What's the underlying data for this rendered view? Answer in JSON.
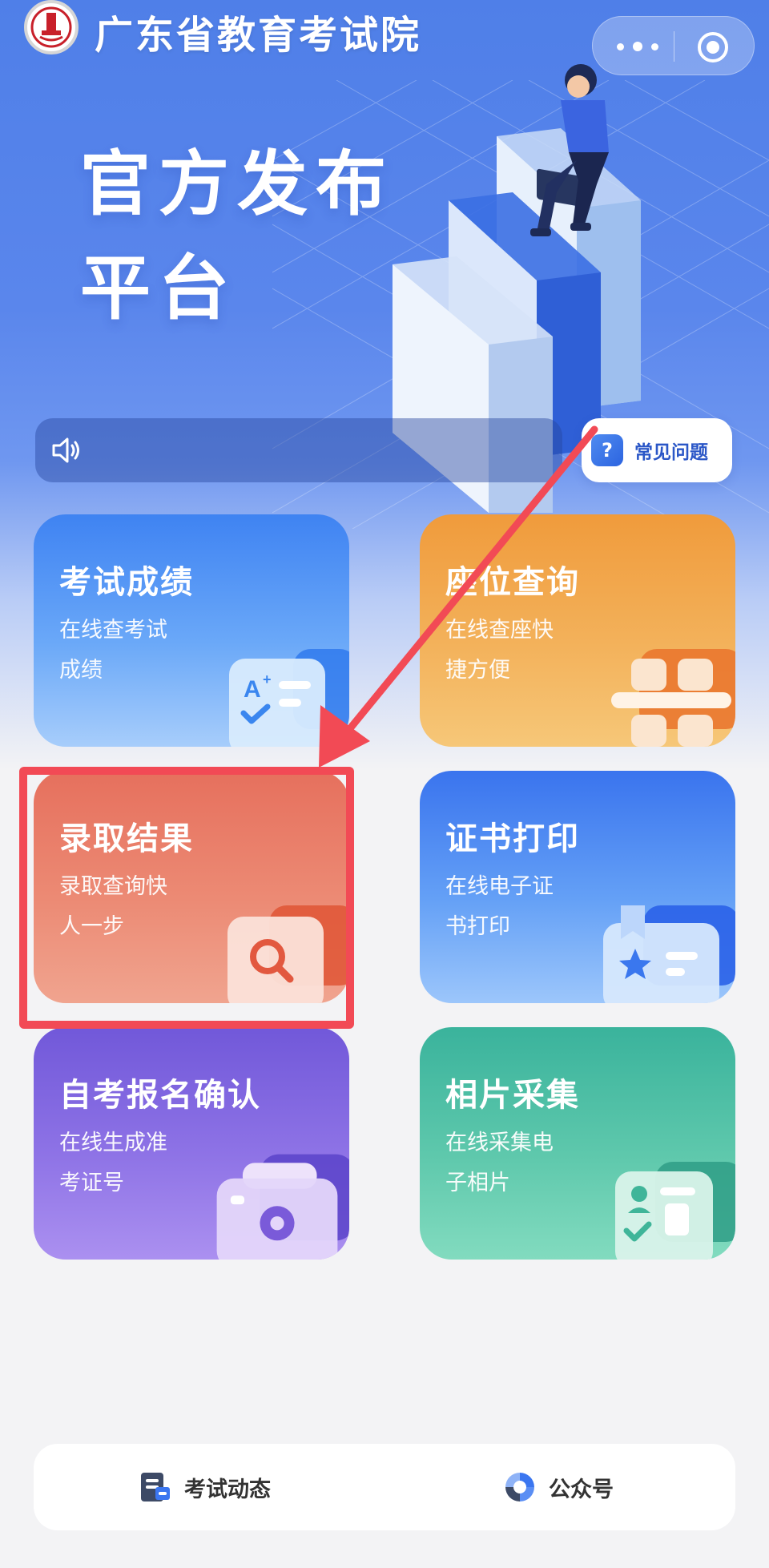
{
  "header": {
    "site_title": "广东省教育考试院",
    "logo_icon": "exam-authority-logo-icon",
    "capsule": {
      "more_icon": "more-dots-icon",
      "close_icon": "target-circle-icon"
    }
  },
  "hero": {
    "heading_line1": "官方发布",
    "heading_line2": "平台"
  },
  "notice": {
    "icon": "speaker-icon",
    "text": ""
  },
  "faq": {
    "icon": "question-icon",
    "label": "常见问题"
  },
  "cards": [
    {
      "title": "考试成绩",
      "desc_line1": "在线查考试",
      "desc_line2": "成绩",
      "icon": "score-sheet-icon",
      "color": "#3f83f2"
    },
    {
      "title": "座位查询",
      "desc_line1": "在线查座快",
      "desc_line2": "捷方便",
      "icon": "seat-grid-icon",
      "color": "#f09b3c"
    },
    {
      "title": "录取结果",
      "desc_line1": "录取查询快",
      "desc_line2": "人一步",
      "icon": "search-document-icon",
      "color": "#e6705d"
    },
    {
      "title": "证书打印",
      "desc_line1": "在线电子证",
      "desc_line2": "书打印",
      "icon": "certificate-star-icon",
      "color": "#3a74ee"
    },
    {
      "title": "自考报名确认",
      "desc_line1": "在线生成准",
      "desc_line2": "考证号",
      "icon": "camera-icon",
      "color": "#7158d9"
    },
    {
      "title": "相片采集",
      "desc_line1": "在线采集电",
      "desc_line2": "子相片",
      "icon": "id-photo-check-icon",
      "color": "#3ab39c"
    }
  ],
  "annotation": {
    "highlight_color": "#f24a55"
  },
  "bottom_nav": [
    {
      "label": "考试动态",
      "icon": "news-icon"
    },
    {
      "label": "公众号",
      "icon": "official-account-icon"
    }
  ]
}
